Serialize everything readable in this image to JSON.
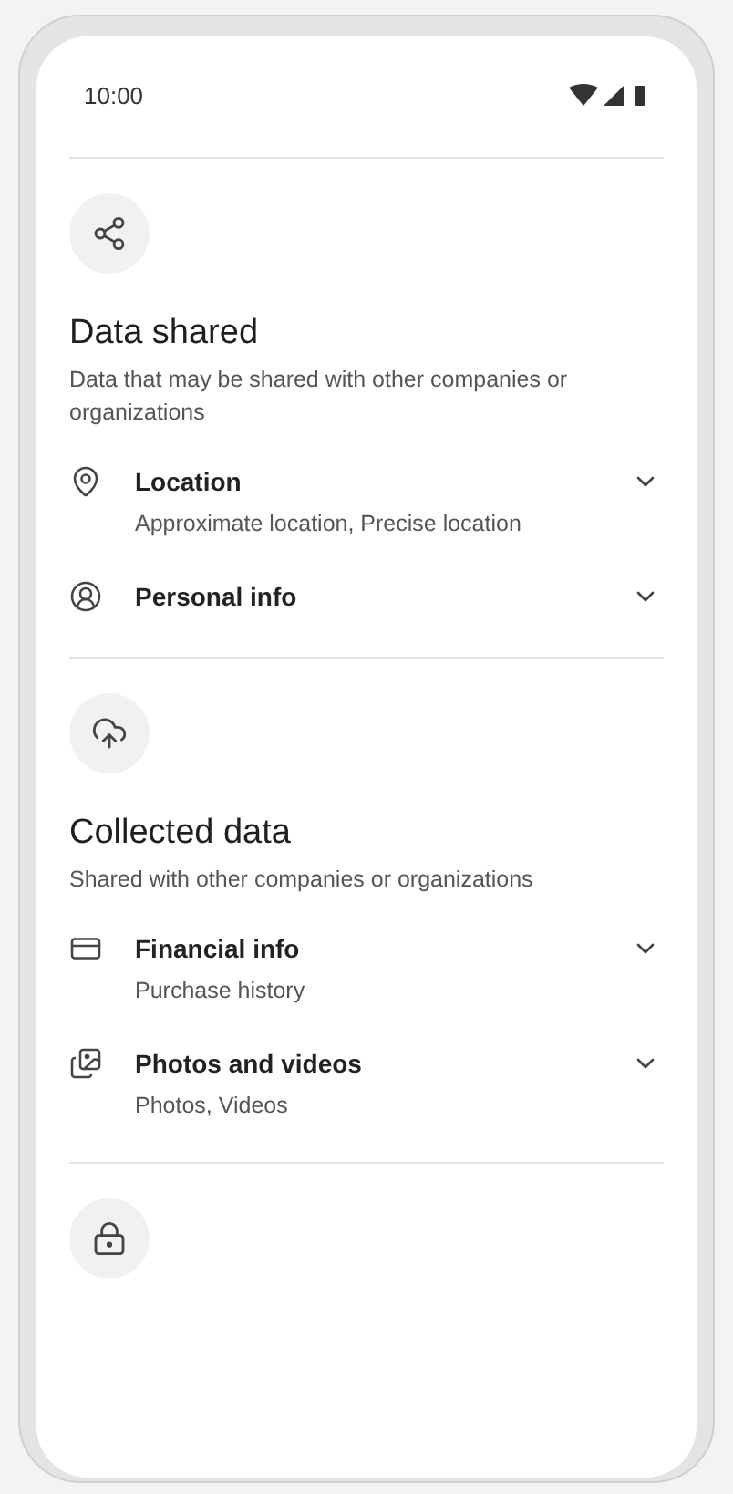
{
  "status_bar": {
    "time": "10:00"
  },
  "sections": [
    {
      "kind": "share",
      "title": "Data shared",
      "subtitle": "Data that may be shared with other companies or organizations",
      "items": [
        {
          "kind": "location",
          "label": "Location",
          "detail": "Approximate location, Precise location",
          "expanded": false
        },
        {
          "kind": "person",
          "label": "Personal info",
          "expanded": false
        }
      ]
    },
    {
      "kind": "cloud",
      "title": "Collected data",
      "subtitle": "Shared with other companies or organizations",
      "items": [
        {
          "kind": "card",
          "label": "Financial info",
          "detail": "Purchase history",
          "expanded": false
        },
        {
          "kind": "photos",
          "label": "Photos and videos",
          "detail": "Photos, Videos",
          "expanded": false
        }
      ]
    },
    {
      "kind": "lock"
    }
  ]
}
